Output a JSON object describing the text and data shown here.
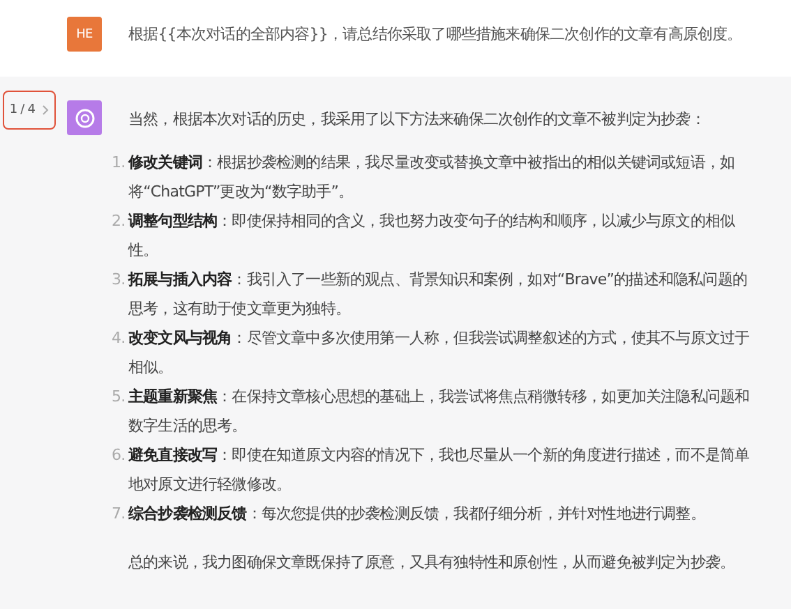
{
  "user_message": {
    "avatar": "HE",
    "text": "根据{{本次对话的全部内容}}，请总结你采取了哪些措施来确保二次创作的文章有高原创度。"
  },
  "assistant_message": {
    "pager": "1 / 4",
    "intro": "当然，根据本次对话的历史，我采用了以下方法来确保二次创作的文章不被判定为抄袭：",
    "items": [
      {
        "number": "1.",
        "text": "**修改关键词**：根据抄袭检测的结果，我尽量改变或替换文章中被指出的相似关键词或短语，如将“ChatGPT”更改为“数字助手”。"
      },
      {
        "number": "2.",
        "text": "**调整句型结构**：即使保持相同的含义，我也努力改变句子的结构和顺序，以减少与原文的相似性。"
      },
      {
        "number": "3.",
        "text": "**拓展与插入内容**：我引入了一些新的观点、背景知识和案例，如对“Brave”的描述和隐私问题的思考，这有助于使文章更为独特。"
      },
      {
        "number": "4.",
        "text": "**改变文风与视角**：尽管文章中多次使用第一人称，但我尝试调整叙述的方式，使其不与原文过于相似。"
      },
      {
        "number": "5.",
        "text": "**主题重新聚焦**：在保持文章核心思想的基础上，我尝试将焦点稍微转移，如更加关注隐私问题和数字生活的思考。"
      },
      {
        "number": "6.",
        "text": "**避免直接改写**：即使在知道原文内容的情况下，我也尽量从一个新的角度进行描述，而不是简单地对原文进行轻微修改。"
      },
      {
        "number": "7.",
        "text": "**综合抄袭检测反馈**：每次您提供的抄袭检测反馈，我都仔细分析，并针对性地进行调整。"
      }
    ],
    "conclusion": "总的来说，我力图确保文章既保持了原意，又具有独特性和原创性，从而避免被判定为抄袭。"
  }
}
